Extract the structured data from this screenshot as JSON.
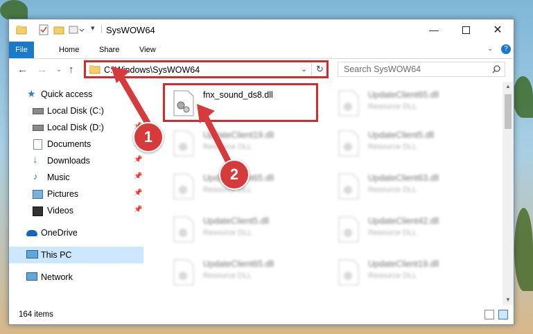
{
  "window": {
    "title": "SysWOW64"
  },
  "ribbon": {
    "tabs": [
      "File",
      "Home",
      "Share",
      "View"
    ]
  },
  "address": {
    "path": "C:\\Windows\\SysWOW64"
  },
  "search": {
    "placeholder": "Search SysWOW64"
  },
  "sidebar": {
    "items": [
      {
        "label": "Quick access",
        "icon": "star-icon"
      },
      {
        "label": "Local Disk (C:)",
        "icon": "disk-icon"
      },
      {
        "label": "Local Disk (D:)",
        "icon": "disk-icon"
      },
      {
        "label": "Documents",
        "icon": "documents-icon"
      },
      {
        "label": "Downloads",
        "icon": "download-icon"
      },
      {
        "label": "Music",
        "icon": "music-icon"
      },
      {
        "label": "Pictures",
        "icon": "pictures-icon"
      },
      {
        "label": "Videos",
        "icon": "videos-icon"
      },
      {
        "label": "OneDrive",
        "icon": "cloud-icon"
      },
      {
        "label": "This PC",
        "icon": "computer-icon"
      },
      {
        "label": "Network",
        "icon": "network-icon"
      }
    ]
  },
  "files": {
    "highlighted": {
      "name": "fnx_sound_ds8.dll"
    },
    "col1": [
      {
        "name": "UpdateClient19.dll",
        "type": "Resource DLL"
      },
      {
        "name": "UpdateClient65.dll",
        "type": "Resource DLL"
      },
      {
        "name": "UpdateClient5.dll",
        "type": "Resource DLL"
      },
      {
        "name": "UpdateClient65.dll",
        "type": "Resource DLL"
      }
    ],
    "col2": [
      {
        "name": "UpdateClient65.dll",
        "type": "Resource DLL"
      },
      {
        "name": "UpdateClient5.dll",
        "type": "Resource DLL"
      },
      {
        "name": "UpdateClient63.dll",
        "type": "Resource DLL"
      },
      {
        "name": "UpdateClient42.dll",
        "type": "Resource DLL"
      },
      {
        "name": "UpdateClient19.dll",
        "type": "Resource DLL"
      }
    ]
  },
  "status": {
    "count": "164 items"
  },
  "annotations": {
    "badge1": "1",
    "badge2": "2"
  },
  "colors": {
    "accent": "#1979ca",
    "highlight": "#d42a2a",
    "selection": "#cce8ff"
  }
}
